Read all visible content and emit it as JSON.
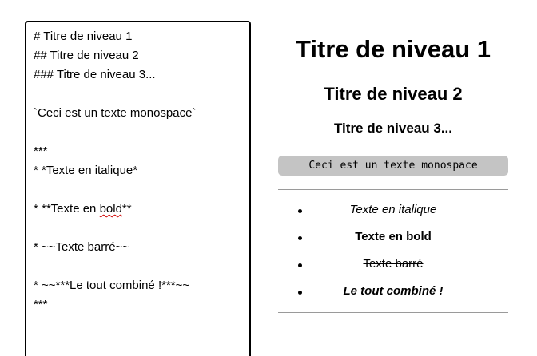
{
  "editor": {
    "lines": [
      "# Titre de niveau 1",
      "## Titre de niveau 2",
      "### Titre de niveau 3...",
      "",
      "`Ceci est un texte monospace`",
      "",
      "***",
      "* *Texte en italique*",
      "",
      "* **Texte en bold**",
      "",
      "* ~~Texte barré~~",
      "",
      "* ~~***Le tout combiné !***~~",
      "***"
    ],
    "line9_prefix": "* **Texte en ",
    "line9_misspelled": "bold",
    "line9_suffix": "**"
  },
  "preview": {
    "h1": "Titre de niveau 1",
    "h2": "Titre de niveau 2",
    "h3": "Titre de niveau 3...",
    "code": "Ceci est un texte monospace",
    "list": [
      "Texte en italique",
      "Texte en bold",
      "Texte barré",
      "Le tout combiné !"
    ]
  },
  "colors": {
    "code_background": "#c4c4c4",
    "rule": "#9a9a9a",
    "spellcheck_underline": "#d00000"
  }
}
